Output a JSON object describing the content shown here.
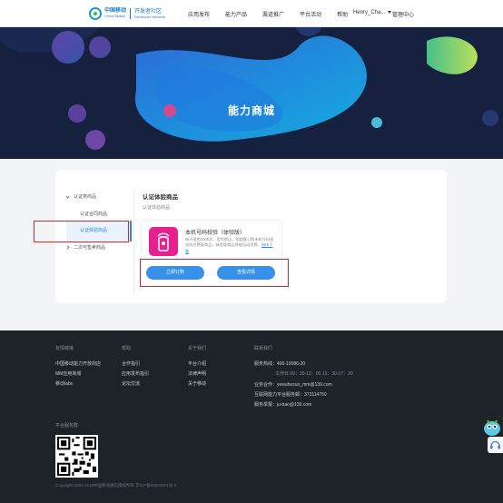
{
  "header": {
    "logo_cn": "中国移动",
    "logo_en": "China Mobile",
    "community": "开发者社区",
    "community_en": "Developer Network",
    "nav": [
      "应用发布",
      "能力产品",
      "渠道推广",
      "平台活动",
      "帮助"
    ],
    "user": "Henry_Cha...",
    "manage": "管理中心"
  },
  "banner": {
    "title": "能力商城"
  },
  "sidebar": {
    "group1": "认证类商品",
    "item1": "认证合同商品",
    "item2_active": "认证体验商品",
    "group2": "二次可售卖商品"
  },
  "content": {
    "title": "认证体验商品",
    "subtitle": "认证体验商品"
  },
  "product": {
    "name": "本机号码校验（体验版）",
    "desc": "每天限免1000次，用完即止。如超额订购未机号码校验的付费版商品，体验版商品将被自动续费。",
    "sdk_link": "SDK下载",
    "buy_label": "立即订购",
    "detail_label": "查看详情"
  },
  "footer": {
    "col1": {
      "head": "友情链接",
      "links": [
        "中国移动能力开放商店",
        "MM应用商城",
        "移动labs"
      ]
    },
    "col2": {
      "head": "帮助",
      "links": [
        "合作指引",
        "应用发布指引",
        "论坛交流"
      ]
    },
    "col3": {
      "head": "关于我们",
      "links": [
        "平台介绍",
        "法律声明",
        "关于移动"
      ]
    },
    "col4": {
      "head": "联系我们",
      "hotline": "服务热线：400-10086-20",
      "hours": "工作日 09：30-12：00 13：30-17：30",
      "biz": "业务合作：yewuhezuo_mm@139.com",
      "email": "互联网能力平台服务邮：373114750",
      "report": "服务举报：ju-bao@139.com"
    },
    "qr_label": "平台服务群",
    "copyright": "Copyright 2004-2018中国移动通信版权所有     京ICP备05002571号-5"
  }
}
